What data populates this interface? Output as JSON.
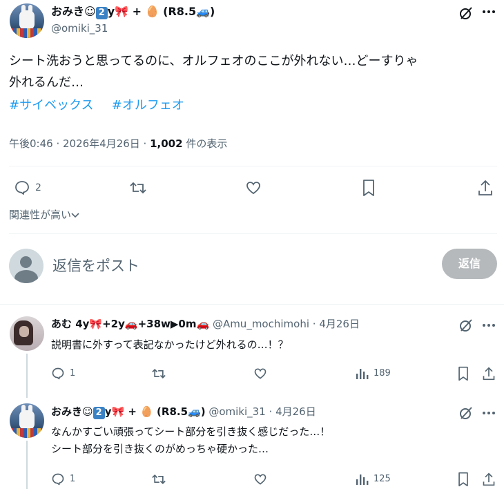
{
  "tweet": {
    "author_name": "おみき☺",
    "author_badge_num": "2",
    "author_suffix": "y🎀 + 🥚 (R8.5🚙)",
    "handle": "@omiki_31",
    "text_line1": "シート洗おうと思ってるのに、オルフェオのここが外れない…どーすりゃ",
    "text_line2": "外れるんだ…",
    "hashtags": [
      "#サイベックス",
      "#オルフェオ"
    ],
    "timestamp": "午後0:46 · 2026年4月26日 · ",
    "views_count": "1,002",
    "views_label": " 件の表示",
    "reply_count": "2",
    "relevance_label": "関連性が高い",
    "reply_placeholder": "返信をポスト",
    "reply_button": "返信"
  },
  "replies": [
    {
      "name": "あむ 4y🎀+2y🚗+38w▶0m🚗",
      "handle": "@Amu_mochimohi",
      "date": "· 4月26日",
      "text": "説明書に外すって表記なかったけど外れるの…！？",
      "reply_count": "1",
      "view_count": "189"
    },
    {
      "name": "おみき☺",
      "badge_num": "2",
      "suffix": "y🎀 + 🥚 (R8.5🚙)",
      "handle": "@omiki_31",
      "date": "· 4月26日",
      "text_line1": "なんかすごい頑張ってシート部分を引き抜く感じだった…！",
      "text_line2": "シート部分を引き抜くのがめっちゃ硬かった…",
      "reply_count": "1",
      "view_count": "125"
    }
  ],
  "icons": [
    "grok-icon",
    "more-icon",
    "reply-icon",
    "retweet-icon",
    "like-icon",
    "bookmark-icon",
    "share-icon",
    "views-icon",
    "chevron-down-icon"
  ],
  "colors": {
    "link": "#1d9bf0",
    "muted": "#536471",
    "text": "#0f1419",
    "reply_button_disabled": "#b5b9bc"
  }
}
